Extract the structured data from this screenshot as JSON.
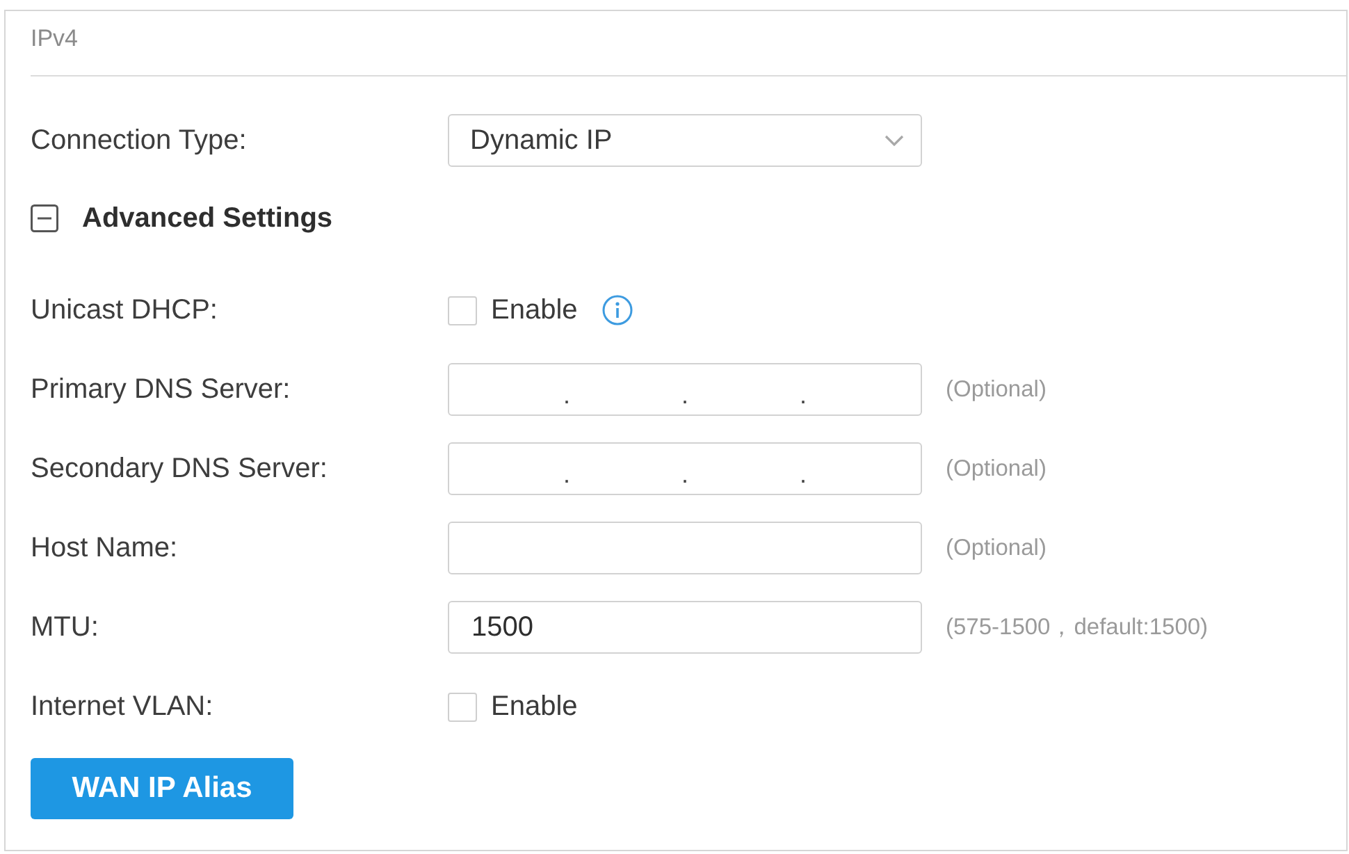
{
  "panel": {
    "title": "IPv4"
  },
  "connection_type": {
    "label": "Connection Type:",
    "value": "Dynamic IP"
  },
  "advanced_settings": {
    "label": "Advanced Settings",
    "expanded": true,
    "fields": [
      {
        "kind": "checkbox",
        "label": "Unicast DHCP:",
        "option": "Enable",
        "checked": false,
        "info": true
      },
      {
        "kind": "ip",
        "label": "Primary DNS Server:",
        "separators": [
          ".",
          ".",
          "."
        ],
        "hint": "(Optional)"
      },
      {
        "kind": "ip",
        "label": "Secondary DNS Server:",
        "separators": [
          ".",
          ".",
          "."
        ],
        "hint": "(Optional)"
      },
      {
        "kind": "text",
        "label": "Host Name:",
        "hint": "(Optional)"
      },
      {
        "kind": "text",
        "label": "MTU:",
        "value": "1500",
        "hint": "(575-1500，default:1500)"
      },
      {
        "kind": "checkbox",
        "label": "Internet VLAN:",
        "option": "Enable",
        "checked": false,
        "info": false
      }
    ]
  },
  "buttons": [
    {
      "label": "WAN IP Alias"
    }
  ]
}
